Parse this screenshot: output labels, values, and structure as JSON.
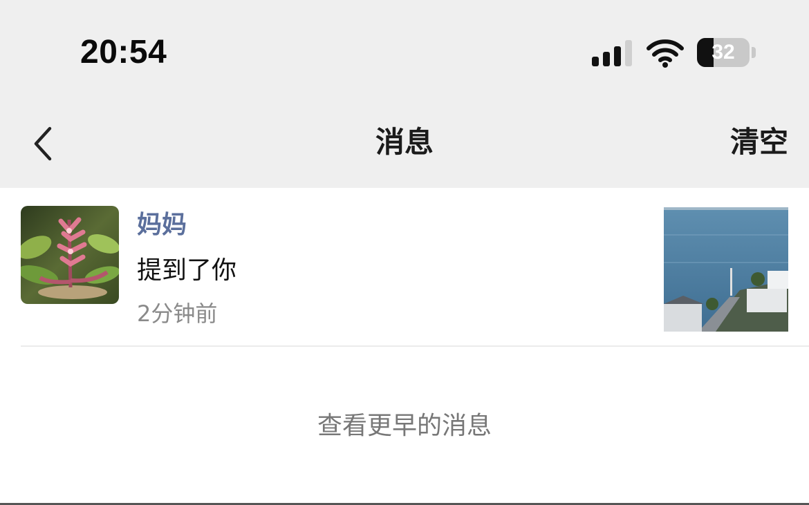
{
  "status_bar": {
    "time": "20:54",
    "signal_bars_filled": 3,
    "signal_bars_total": 4,
    "battery_level": "32"
  },
  "nav": {
    "back_icon": "chevron-left-icon",
    "title": "消息",
    "clear_label": "清空"
  },
  "messages": [
    {
      "sender": "妈妈",
      "text": "提到了你",
      "time": "2分钟前",
      "avatar": "flower-photo",
      "thumbnail": "seaside-photo"
    }
  ],
  "footer": {
    "view_earlier": "查看更早的消息"
  },
  "colors": {
    "header_bg": "#efefef",
    "sender_name": "#5b6f9c",
    "secondary_text": "#8a8a8a"
  }
}
